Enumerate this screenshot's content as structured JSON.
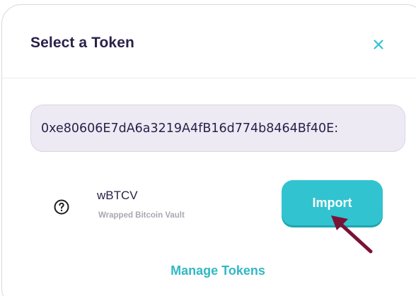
{
  "modal": {
    "title": "Select a Token",
    "close_icon": "close-icon"
  },
  "search": {
    "value": "0xe80606E7dA6a3219A4fB16d774b8464Bf40E",
    "display_value": "0xe80606E7dA6a3219A4fB16d774b8464Bf40E:"
  },
  "token": {
    "symbol": "wBTCV",
    "name": "Wrapped Bitcoin Vault",
    "icon": "question-circle-icon"
  },
  "actions": {
    "import_label": "Import",
    "manage_tokens_label": "Manage Tokens"
  },
  "colors": {
    "accent": "#31c3cf",
    "title": "#2a2149",
    "input_bg": "#eeeaf4",
    "arrow": "#7a1236"
  }
}
